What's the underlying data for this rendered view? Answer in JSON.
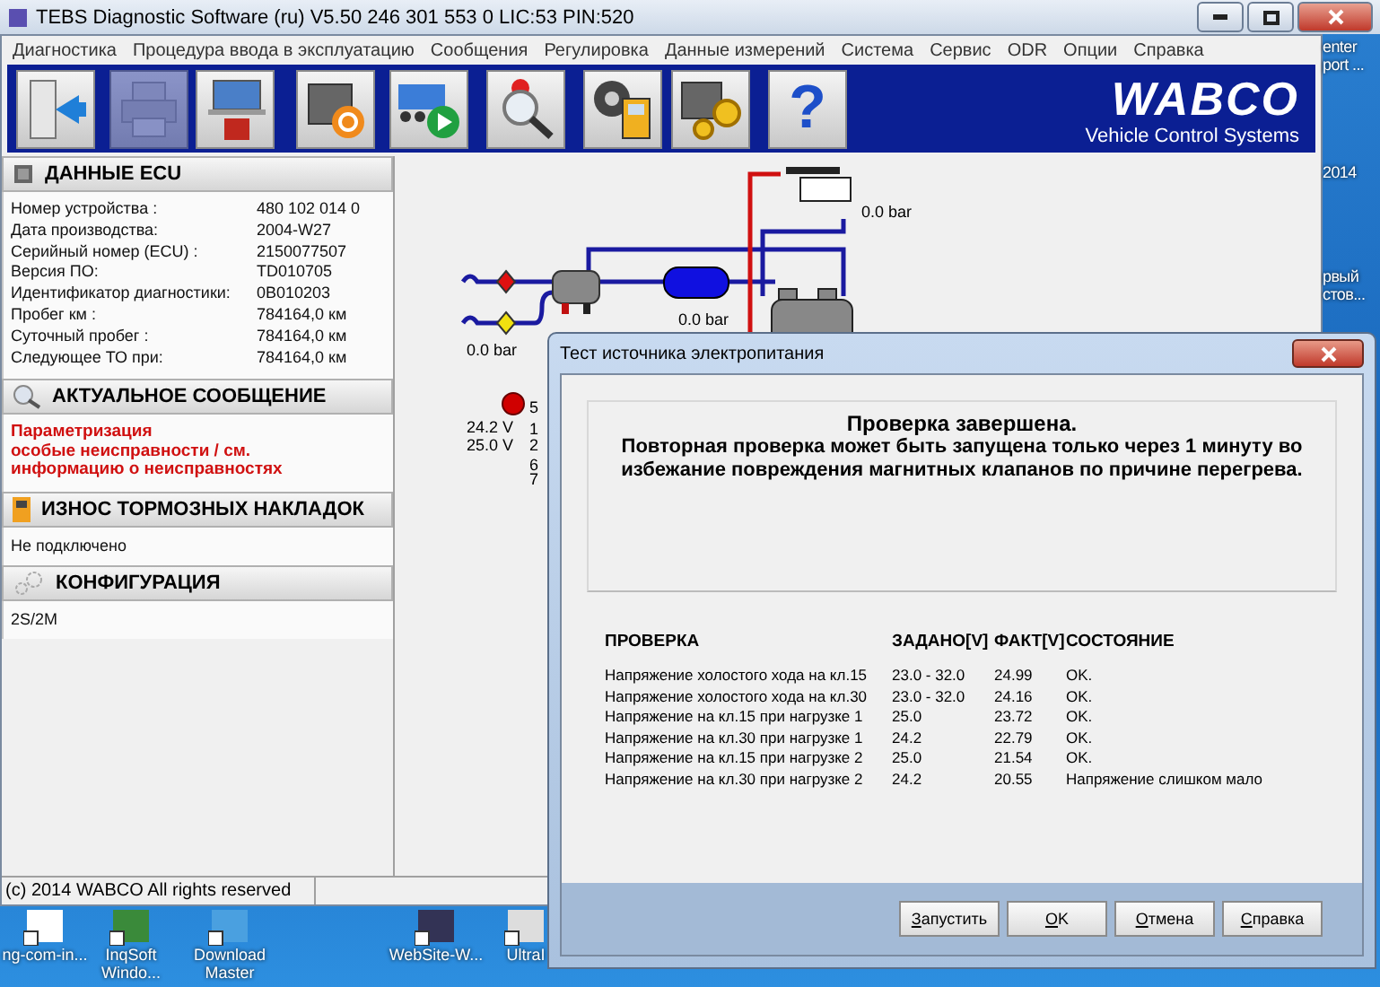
{
  "window": {
    "title": "TEBS Diagnostic Software (ru) V5.50  246 301 553 0  LIC:53 PIN:520"
  },
  "menu": [
    "Диагностика",
    "Процедура ввода в эксплуатацию",
    "Сообщения",
    "Регулировка",
    "Данные измерений",
    "Система",
    "Сервис",
    "ODR",
    "Опции",
    "Справка"
  ],
  "toolbar": {
    "buttons": [
      {
        "kind": "exit",
        "disabled": false
      },
      {
        "kind": "print",
        "disabled": true
      },
      {
        "kind": "laptop",
        "disabled": false
      },
      {
        "kind": "ecu-refresh",
        "disabled": false
      },
      {
        "kind": "truck-play",
        "disabled": false
      },
      {
        "kind": "magnifier",
        "disabled": false
      },
      {
        "kind": "meter",
        "disabled": false
      },
      {
        "kind": "ecu-gears",
        "disabled": false
      },
      {
        "kind": "help",
        "disabled": false,
        "glyph": "?"
      }
    ]
  },
  "logo": {
    "name": "WABCO",
    "tagline": "Vehicle Control Systems"
  },
  "sections": [
    {
      "kind": "fields",
      "title": "ДАННЫЕ ECU",
      "fields": [
        {
          "label": "Номер устройства :",
          "value": "480 102 014 0"
        },
        {
          "label": "Дата производства:",
          "value": "2004-W27"
        },
        {
          "label": "Серийный номер (ECU) :",
          "value": "2150077507"
        },
        {
          "label": "Версия ПО:",
          "value": "TD010705"
        },
        {
          "label": "Идентификатор диагностики:",
          "value": "0B010203"
        },
        {
          "label": "Пробег км :",
          "value": "784164,0 км"
        },
        {
          "label": "Суточный пробег :",
          "value": "784164,0 км"
        },
        {
          "label": "Следующее ТО при:",
          "value": "784164,0 км"
        }
      ]
    },
    {
      "kind": "alert",
      "title": "АКТУАЛЬНОЕ СООБЩЕНИЕ",
      "lines": [
        "Параметризация",
        "особые неисправности / см.",
        "информацию о неисправностях"
      ]
    },
    {
      "kind": "text",
      "title": "ИЗНОС ТОРМОЗНЫХ НАКЛАДОК",
      "text": "Не подключено"
    },
    {
      "kind": "text",
      "title": "КОНФИГУРАЦИЯ",
      "text": "2S/2M"
    }
  ],
  "diagram": {
    "pressures": [
      "0.0 bar",
      "0.0 bar",
      "0.0 bar"
    ],
    "voltages": [
      "24.2 V",
      "25.0 V"
    ],
    "pins": [
      "5",
      "1",
      "2",
      "6",
      "7"
    ]
  },
  "status_bar": {
    "text": "(c) 2014 WABCO All rights reserved"
  },
  "dialog": {
    "title": "Тест источника электропитания",
    "heading": "Проверка завершена.",
    "message": "Повторная проверка может быть запущена только через 1 минуту во избежание повреждения магнитных клапанов по причине перегрева.",
    "columns": [
      "ПРОВЕРКА",
      "ЗАДАНО[V]",
      "ФАКТ[V]",
      "СОСТОЯНИЕ"
    ],
    "rows": [
      [
        "Напряжение холостого хода на кл.15",
        "23.0 - 32.0",
        "24.99",
        "OK."
      ],
      [
        "Напряжение холостого хода на кл.30",
        "23.0 - 32.0",
        "24.16",
        "OK."
      ],
      [
        "Напряжение на кл.15 при нагрузке 1",
        "25.0",
        "23.72",
        "OK."
      ],
      [
        "Напряжение на кл.30 при нагрузке 1",
        "24.2",
        "22.79",
        "OK."
      ],
      [
        "Напряжение на кл.15 при нагрузке 2",
        "25.0",
        "21.54",
        "OK."
      ],
      [
        "Напряжение на кл.30 при нагрузке 2",
        "24.2",
        "20.55",
        "Напряжение слишком мало"
      ]
    ],
    "buttons": [
      "Запустить",
      "OK",
      "Отмена",
      "Справка"
    ]
  },
  "desktop": {
    "side_labels": [
      "enter",
      "port ...",
      "2014",
      "рвый",
      "стов..."
    ],
    "icons": [
      "ng-com-in...",
      "InqSoft Windo...",
      "Download Master",
      "WebSite-W...",
      "UltraI"
    ]
  }
}
